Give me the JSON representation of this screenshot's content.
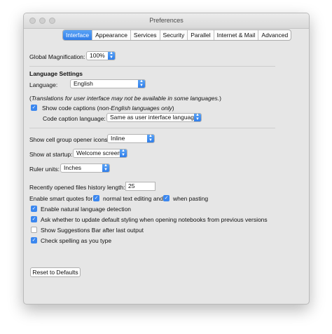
{
  "window": {
    "title": "Preferences"
  },
  "tabs": [
    "Interface",
    "Appearance",
    "Services",
    "Security",
    "Parallel",
    "Internet & Mail",
    "Advanced"
  ],
  "active_tab": "Interface",
  "magnification": {
    "label": "Global Magnification:",
    "value": "100%"
  },
  "language": {
    "heading": "Language Settings",
    "label": "Language:",
    "value": "English",
    "note": "(Translations for user interface may not be available in some languages.)",
    "note_prefix": "(",
    "note_italic": "Translations for user interface may not be available in some languages.",
    "note_suffix": ")",
    "captions_label": "Show code captions (",
    "captions_italic": "non-English languages only",
    "captions_suffix": ")",
    "captions_checked": true,
    "caption_lang_label": "Code caption language:",
    "caption_lang_value": "Same as user interface language"
  },
  "cell_group": {
    "label": "Show cell group opener icons:",
    "value": "Inline"
  },
  "startup": {
    "label": "Show at startup:",
    "value": "Welcome screen"
  },
  "ruler": {
    "label": "Ruler units:",
    "value": "Inches"
  },
  "history": {
    "label": "Recently opened files history length:",
    "value": "25"
  },
  "smart_quotes": {
    "label": "Enable smart quotes for",
    "opt1": "normal text editing and",
    "opt1_checked": true,
    "opt2": "when pasting",
    "opt2_checked": true
  },
  "checkboxes": [
    {
      "label": "Enable natural language detection",
      "checked": true
    },
    {
      "label": "Ask whether to update default styling when opening notebooks from previous versions",
      "checked": true
    },
    {
      "label": "Show Suggestions Bar after last output",
      "checked": false
    },
    {
      "label": "Check spelling as you type",
      "checked": true
    }
  ],
  "reset_button": "Reset to Defaults"
}
